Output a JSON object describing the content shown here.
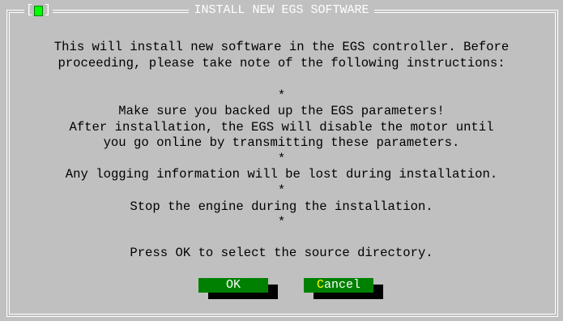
{
  "dialog": {
    "title": "INSTALL NEW EGS SOFTWARE",
    "close_open": "[",
    "close_close": "]",
    "lines": [
      "This will install new software in the EGS controller. Before",
      "proceeding, please take note of the following instructions:",
      "*",
      "Make sure you backed up the EGS parameters!",
      "After installation, the EGS will disable the motor until",
      "you go online by transmitting these parameters.",
      "*",
      "Any logging information will be lost during installation.",
      "*",
      "Stop the engine during the installation.",
      "*",
      "Press OK to select the source directory."
    ]
  },
  "buttons": {
    "ok_label": "OK",
    "cancel_hotkey": "C",
    "cancel_rest": "ancel"
  },
  "colors": {
    "background": "#c0c0c0",
    "frame": "#ffffff",
    "button": "#008000",
    "button_text": "#ffffff",
    "hotkey": "#ffff00",
    "close_indicator": "#00ff00"
  }
}
